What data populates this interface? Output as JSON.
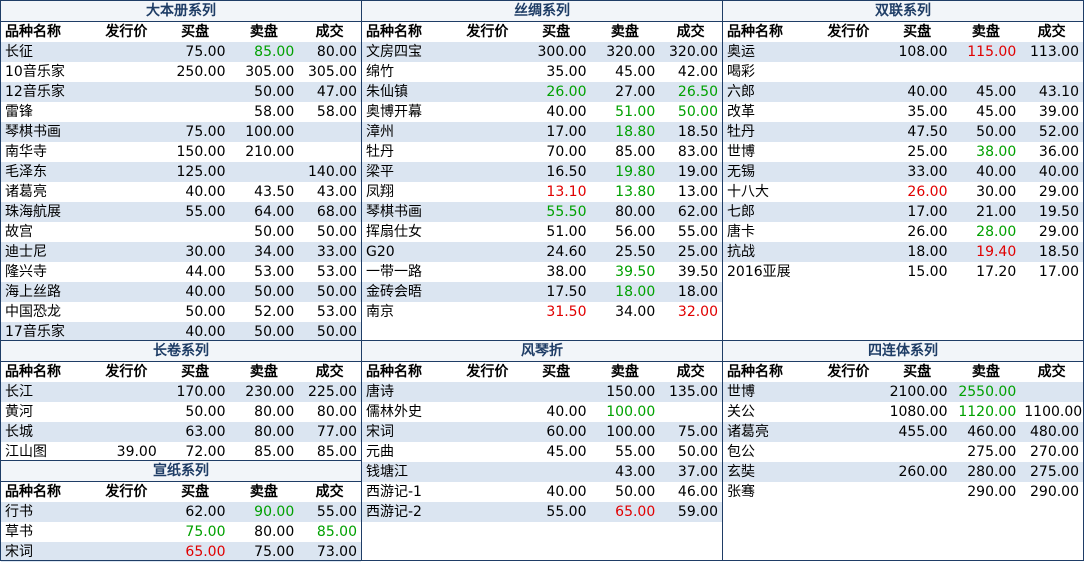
{
  "headers": [
    "品种名称",
    "发行价",
    "买盘",
    "卖盘",
    "成交"
  ],
  "sections": [
    {
      "title": "大本册系列",
      "rows": [
        {
          "name": "长征",
          "issue": "",
          "buy": "75.00",
          "sell": "85.00",
          "deal": "80.00",
          "sell_color": "green"
        },
        {
          "name": "10音乐家",
          "issue": "",
          "buy": "250.00",
          "sell": "305.00",
          "deal": "305.00"
        },
        {
          "name": "12音乐家",
          "issue": "",
          "buy": "",
          "sell": "50.00",
          "deal": "47.00"
        },
        {
          "name": "雷锋",
          "issue": "",
          "buy": "",
          "sell": "58.00",
          "deal": "58.00"
        },
        {
          "name": "琴棋书画",
          "issue": "",
          "buy": "75.00",
          "sell": "100.00",
          "deal": ""
        },
        {
          "name": "南华寺",
          "issue": "",
          "buy": "150.00",
          "sell": "210.00",
          "deal": ""
        },
        {
          "name": "毛泽东",
          "issue": "",
          "buy": "125.00",
          "sell": "",
          "deal": "140.00"
        },
        {
          "name": "诸葛亮",
          "issue": "",
          "buy": "40.00",
          "sell": "43.50",
          "deal": "43.00"
        },
        {
          "name": "珠海航展",
          "issue": "",
          "buy": "55.00",
          "sell": "64.00",
          "deal": "68.00"
        },
        {
          "name": "故宫",
          "issue": "",
          "buy": "",
          "sell": "50.00",
          "deal": "50.00"
        },
        {
          "name": "迪士尼",
          "issue": "",
          "buy": "30.00",
          "sell": "34.00",
          "deal": "33.00"
        },
        {
          "name": "隆兴寺",
          "issue": "",
          "buy": "44.00",
          "sell": "53.00",
          "deal": "53.00"
        },
        {
          "name": "海上丝路",
          "issue": "",
          "buy": "40.00",
          "sell": "50.00",
          "deal": "50.00"
        },
        {
          "name": "中国恐龙",
          "issue": "",
          "buy": "50.00",
          "sell": "52.00",
          "deal": "53.00"
        },
        {
          "name": "17音乐家",
          "issue": "",
          "buy": "40.00",
          "sell": "50.00",
          "deal": "50.00"
        }
      ]
    },
    {
      "title": "丝绸系列",
      "rows": [
        {
          "name": "文房四宝",
          "issue": "",
          "buy": "300.00",
          "sell": "320.00",
          "deal": "320.00"
        },
        {
          "name": "绵竹",
          "issue": "",
          "buy": "35.00",
          "sell": "45.00",
          "deal": "42.00"
        },
        {
          "name": "朱仙镇",
          "issue": "",
          "buy": "26.00",
          "sell": "27.00",
          "deal": "26.50",
          "buy_color": "green",
          "deal_color": "green"
        },
        {
          "name": "奥博开幕",
          "issue": "",
          "buy": "40.00",
          "sell": "51.00",
          "deal": "50.00",
          "sell_color": "green",
          "deal_color": "green"
        },
        {
          "name": "漳州",
          "issue": "",
          "buy": "17.00",
          "sell": "18.80",
          "deal": "18.50",
          "sell_color": "green"
        },
        {
          "name": "牡丹",
          "issue": "",
          "buy": "70.00",
          "sell": "85.00",
          "deal": "83.00"
        },
        {
          "name": "梁平",
          "issue": "",
          "buy": "16.50",
          "sell": "19.80",
          "deal": "19.00",
          "sell_color": "green"
        },
        {
          "name": "凤翔",
          "issue": "",
          "buy": "13.10",
          "sell": "13.80",
          "deal": "13.00",
          "buy_color": "red",
          "sell_color": "green"
        },
        {
          "name": "琴棋书画",
          "issue": "",
          "buy": "55.50",
          "sell": "80.00",
          "deal": "62.00",
          "buy_color": "green"
        },
        {
          "name": "挥扇仕女",
          "issue": "",
          "buy": "51.00",
          "sell": "56.00",
          "deal": "55.00"
        },
        {
          "name": "G20",
          "issue": "",
          "buy": "24.60",
          "sell": "25.50",
          "deal": "25.00"
        },
        {
          "name": "一带一路",
          "issue": "",
          "buy": "38.00",
          "sell": "39.50",
          "deal": "39.50",
          "sell_color": "green"
        },
        {
          "name": "金砖会晤",
          "issue": "",
          "buy": "17.50",
          "sell": "18.00",
          "deal": "18.00",
          "sell_color": "green"
        },
        {
          "name": "南京",
          "issue": "",
          "buy": "31.50",
          "sell": "34.00",
          "deal": "32.00",
          "buy_color": "red",
          "deal_color": "red"
        }
      ]
    },
    {
      "title": "双联系列",
      "rows": [
        {
          "name": "奥运",
          "issue": "",
          "buy": "108.00",
          "sell": "115.00",
          "deal": "113.00",
          "sell_color": "red"
        },
        {
          "name": "喝彩",
          "issue": "",
          "buy": "",
          "sell": "",
          "deal": ""
        },
        {
          "name": "六郎",
          "issue": "",
          "buy": "40.00",
          "sell": "45.00",
          "deal": "43.10"
        },
        {
          "name": "改革",
          "issue": "",
          "buy": "35.00",
          "sell": "45.00",
          "deal": "39.00"
        },
        {
          "name": "牡丹",
          "issue": "",
          "buy": "47.50",
          "sell": "50.00",
          "deal": "52.00"
        },
        {
          "name": "世博",
          "issue": "",
          "buy": "25.00",
          "sell": "38.00",
          "deal": "36.00",
          "sell_color": "green"
        },
        {
          "name": "无锡",
          "issue": "",
          "buy": "33.00",
          "sell": "40.00",
          "deal": "40.00"
        },
        {
          "name": "十八大",
          "issue": "",
          "buy": "26.00",
          "sell": "30.00",
          "deal": "29.00",
          "buy_color": "red"
        },
        {
          "name": "七郎",
          "issue": "",
          "buy": "17.00",
          "sell": "21.00",
          "deal": "19.50"
        },
        {
          "name": "唐卡",
          "issue": "",
          "buy": "26.00",
          "sell": "28.00",
          "deal": "29.00",
          "sell_color": "green"
        },
        {
          "name": "抗战",
          "issue": "",
          "buy": "18.00",
          "sell": "19.40",
          "deal": "18.50",
          "sell_color": "red"
        },
        {
          "name": "2016亚展",
          "issue": "",
          "buy": "15.00",
          "sell": "17.20",
          "deal": "17.00"
        }
      ]
    },
    {
      "title": "长卷系列",
      "rows": [
        {
          "name": "长江",
          "issue": "",
          "buy": "170.00",
          "sell": "230.00",
          "deal": "225.00"
        },
        {
          "name": "黄河",
          "issue": "",
          "buy": "50.00",
          "sell": "80.00",
          "deal": "80.00"
        },
        {
          "name": "长城",
          "issue": "",
          "buy": "63.00",
          "sell": "80.00",
          "deal": "77.00"
        },
        {
          "name": "江山图",
          "issue": "39.00",
          "buy": "72.00",
          "sell": "85.00",
          "deal": "85.00"
        }
      ]
    },
    {
      "title": "宣纸系列",
      "rows": [
        {
          "name": "行书",
          "issue": "",
          "buy": "62.00",
          "sell": "90.00",
          "deal": "55.00",
          "sell_color": "green"
        },
        {
          "name": "草书",
          "issue": "",
          "buy": "75.00",
          "sell": "80.00",
          "deal": "85.00",
          "buy_color": "green",
          "deal_color": "green"
        },
        {
          "name": "宋词",
          "issue": "",
          "buy": "65.00",
          "sell": "75.00",
          "deal": "73.00",
          "buy_color": "red"
        }
      ]
    },
    {
      "title": "风琴折",
      "rows": [
        {
          "name": "唐诗",
          "issue": "",
          "buy": "",
          "sell": "150.00",
          "deal": "135.00"
        },
        {
          "name": "儒林外史",
          "issue": "",
          "buy": "40.00",
          "sell": "100.00",
          "deal": "",
          "sell_color": "green"
        },
        {
          "name": "宋词",
          "issue": "",
          "buy": "60.00",
          "sell": "100.00",
          "deal": "75.00"
        },
        {
          "name": "元曲",
          "issue": "",
          "buy": "45.00",
          "sell": "55.00",
          "deal": "50.00"
        },
        {
          "name": "钱塘江",
          "issue": "",
          "buy": "",
          "sell": "43.00",
          "deal": "37.00"
        },
        {
          "name": "西游记-1",
          "issue": "",
          "buy": "40.00",
          "sell": "50.00",
          "deal": "46.00"
        },
        {
          "name": "西游记-2",
          "issue": "",
          "buy": "55.00",
          "sell": "65.00",
          "deal": "59.00",
          "sell_color": "red"
        }
      ]
    },
    {
      "title": "四连体系列",
      "rows": [
        {
          "name": "世博",
          "issue": "",
          "buy": "2100.00",
          "sell": "2550.00",
          "deal": "",
          "sell_color": "green"
        },
        {
          "name": "关公",
          "issue": "",
          "buy": "1080.00",
          "sell": "1120.00",
          "deal": "1100.00",
          "sell_color": "green"
        },
        {
          "name": "诸葛亮",
          "issue": "",
          "buy": "455.00",
          "sell": "460.00",
          "deal": "480.00"
        },
        {
          "name": "包公",
          "issue": "",
          "buy": "",
          "sell": "275.00",
          "deal": "270.00"
        },
        {
          "name": "玄奘",
          "issue": "",
          "buy": "260.00",
          "sell": "280.00",
          "deal": "275.00"
        },
        {
          "name": "张骞",
          "issue": "",
          "buy": "",
          "sell": "290.00",
          "deal": "290.00"
        }
      ]
    }
  ],
  "colors": {
    "red": "#e00000",
    "green": "#00a000",
    "header_blue": "#1f3d66",
    "stripe": "#dbe5f1"
  }
}
